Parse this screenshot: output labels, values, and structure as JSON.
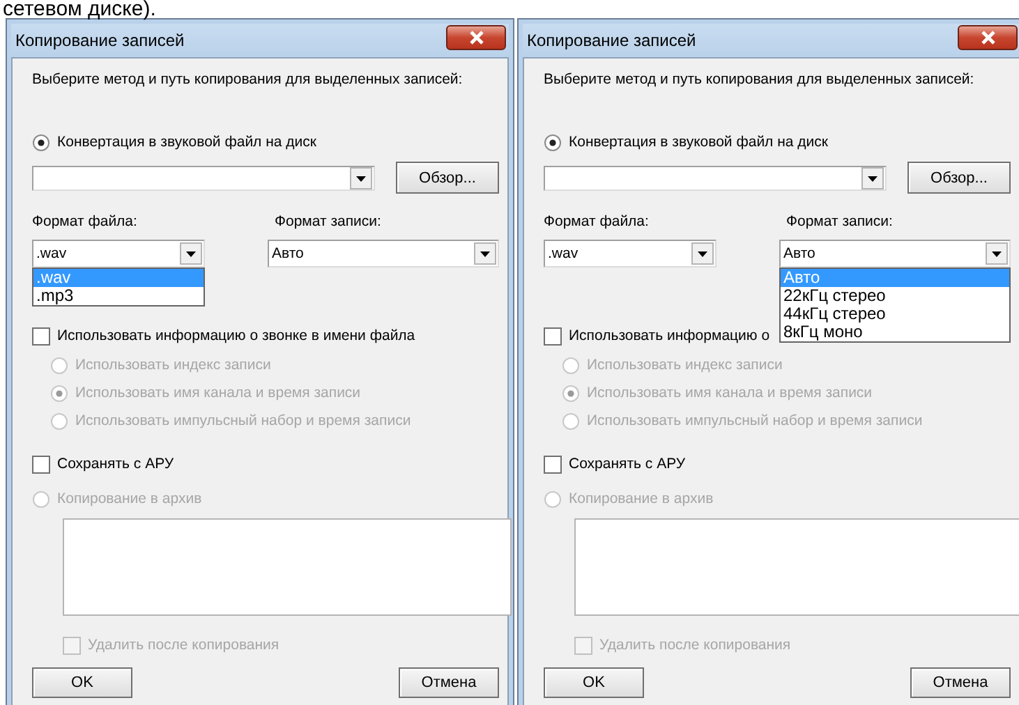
{
  "caption": "сетевом диске).",
  "dialogs": [
    {
      "title": "Копирование записей",
      "prompt": "Выберите метод и путь копирования для выделенных записей:",
      "method": {
        "label": "Конвертация в звуковой файл на диск",
        "selected": true,
        "disabled": false
      },
      "browse_button": "Обзор...",
      "file_format": {
        "label": "Формат файла:",
        "value": ".wav",
        "expanded": true,
        "options": [
          {
            "label": ".wav",
            "selected": true
          },
          {
            "label": ".mp3",
            "selected": false
          }
        ]
      },
      "record_format": {
        "label": "Формат записи:",
        "value": "Авто",
        "expanded": false
      },
      "use_call_info": {
        "label": "Использовать информацию о звонке в имени файла",
        "checked": false,
        "disabled": false
      },
      "naming": [
        {
          "label": "Использовать индекс записи",
          "selected": false,
          "disabled": true
        },
        {
          "label": "Использовать имя канала и время записи",
          "selected": true,
          "disabled": true
        },
        {
          "label": "Использовать импульсный набор и время записи",
          "selected": false,
          "disabled": true
        }
      ],
      "agc": {
        "label": "Сохранять с АРУ",
        "checked": false,
        "disabled": false
      },
      "archive": {
        "label": "Копирование в архив",
        "selected": false,
        "disabled": true
      },
      "delete_after": {
        "label": "Удалить после копирования",
        "checked": false,
        "disabled": true
      },
      "buttons": [
        "OK",
        "Отмена"
      ]
    },
    {
      "title": "Копирование записей",
      "prompt": "Выберите метод и путь копирования для выделенных записей:",
      "method": {
        "label": "Конвертация в звуковой файл на диск",
        "selected": true,
        "disabled": false
      },
      "browse_button": "Обзор...",
      "file_format": {
        "label": "Формат файла:",
        "value": ".wav",
        "expanded": false
      },
      "record_format": {
        "label": "Формат записи:",
        "value": "Авто",
        "expanded": true,
        "options": [
          {
            "label": "Авто",
            "selected": true
          },
          {
            "label": "22кГц стерео",
            "selected": false
          },
          {
            "label": "44кГц стерео",
            "selected": false
          },
          {
            "label": "8кГц моно",
            "selected": false
          }
        ]
      },
      "use_call_info": {
        "label": "Использовать информацию о",
        "checked": false,
        "disabled": false
      },
      "naming": [
        {
          "label": "Использовать индекс записи",
          "selected": false,
          "disabled": true
        },
        {
          "label": "Использовать имя канала и время записи",
          "selected": true,
          "disabled": true
        },
        {
          "label": "Использовать импульсный набор и время записи",
          "selected": false,
          "disabled": true
        }
      ],
      "agc": {
        "label": "Сохранять с АРУ",
        "checked": false,
        "disabled": false
      },
      "archive": {
        "label": "Копирование в архив",
        "selected": false,
        "disabled": true
      },
      "delete_after": {
        "label": "Удалить после копирования",
        "checked": false,
        "disabled": true
      },
      "buttons": [
        "OK",
        "Отмена"
      ]
    }
  ]
}
